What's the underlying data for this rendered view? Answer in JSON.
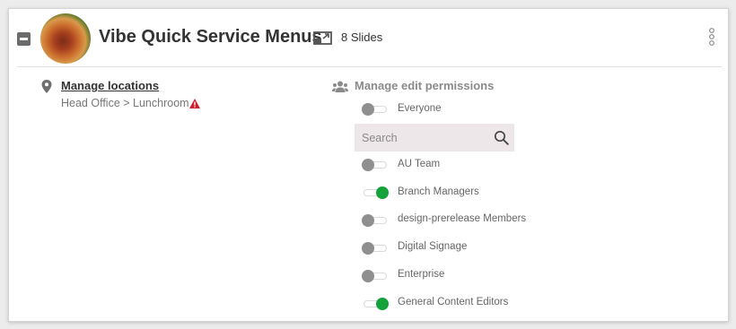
{
  "header": {
    "title": "Vibe Quick Service Menus",
    "slides_count": "8 Slides"
  },
  "locations": {
    "link_label": "Manage locations",
    "path": "Head Office > Lunchroom"
  },
  "permissions": {
    "title": "Manage edit permissions",
    "everyone": {
      "label": "Everyone",
      "enabled": false
    },
    "search": {
      "placeholder": "Search",
      "value": ""
    },
    "groups": [
      {
        "label": "AU Team",
        "enabled": false
      },
      {
        "label": "Branch Managers",
        "enabled": true
      },
      {
        "label": "design-prerelease Members",
        "enabled": false
      },
      {
        "label": "Digital Signage",
        "enabled": false
      },
      {
        "label": "Enterprise",
        "enabled": false
      },
      {
        "label": "General Content Editors",
        "enabled": true
      }
    ]
  },
  "colors": {
    "toggle_on": "#14a33a",
    "toggle_off": "#8f8f8f",
    "warning": "#d0202e"
  }
}
